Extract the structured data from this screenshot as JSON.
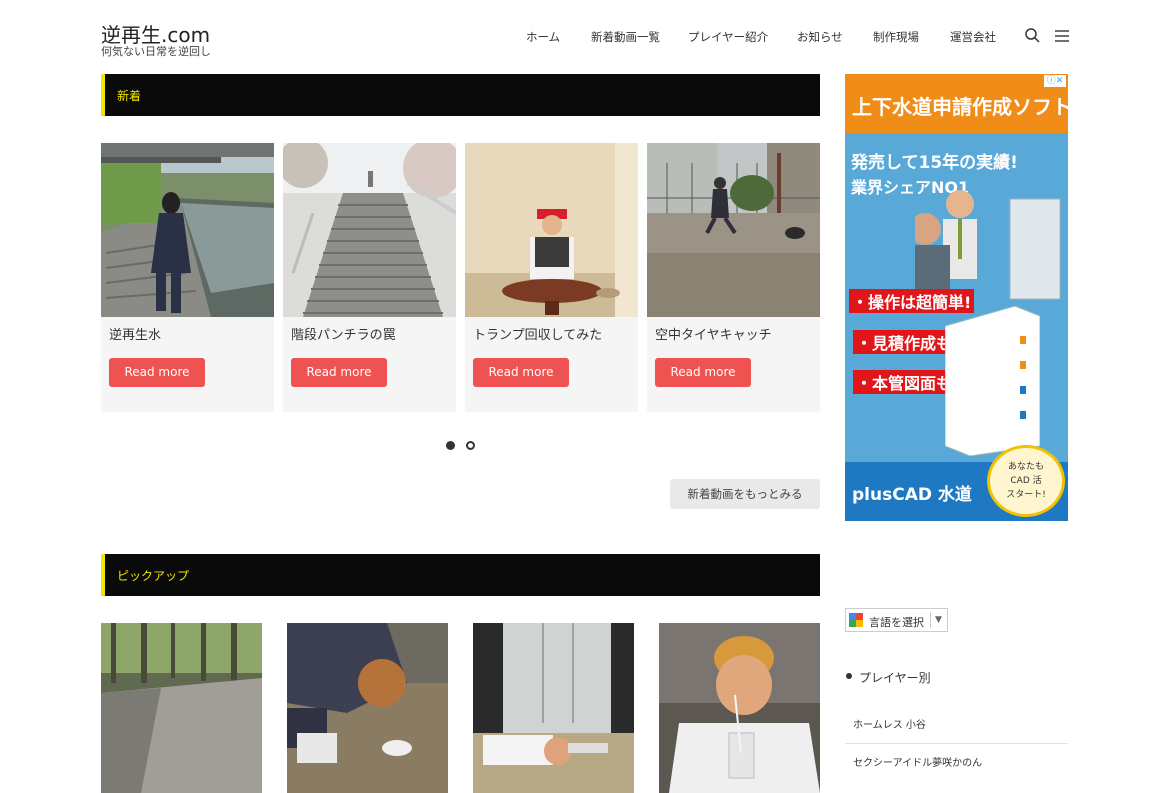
{
  "site": {
    "title": "逆再生.com",
    "tagline": "何気ない日常を逆回し"
  },
  "nav": {
    "items": [
      "ホーム",
      "新着動画一覧",
      "プレイヤー紹介",
      "お知らせ",
      "制作現場",
      "運営会社"
    ],
    "search_icon": "search-icon",
    "menu_icon": "hamburger-menu-icon"
  },
  "sections": {
    "new": "新着",
    "pickup": "ピックアップ"
  },
  "cards": [
    {
      "title": "逆再生水",
      "button": "Read more"
    },
    {
      "title": "階段パンチラの罠",
      "button": "Read more"
    },
    {
      "title": "トランプ回収してみた",
      "button": "Read more"
    },
    {
      "title": "空中タイヤキャッチ",
      "button": "Read more"
    }
  ],
  "carousel": {
    "pages": 2,
    "active": 1
  },
  "more_button": "新着動画をもっとみる",
  "ad": {
    "headline": "上下水道申請作成ソフト",
    "line1": "発売して15年の実績!",
    "line2": "業界シェアNO1",
    "bullet1": "・操作は超簡単!",
    "bullet2": "・見積作成もOK!",
    "bullet3": "・本管図面もOK!",
    "product": "plusCAD 水道",
    "badge1": "あなたも",
    "badge2": "CAD 活",
    "badge3": "スタート!",
    "close": "ⓘ✕"
  },
  "translate": {
    "label": "言語を選択"
  },
  "sidebar": {
    "heading": "プレイヤー別",
    "items": [
      "ホームレス 小谷",
      "セクシーアイドル夢咲かのん"
    ]
  }
}
